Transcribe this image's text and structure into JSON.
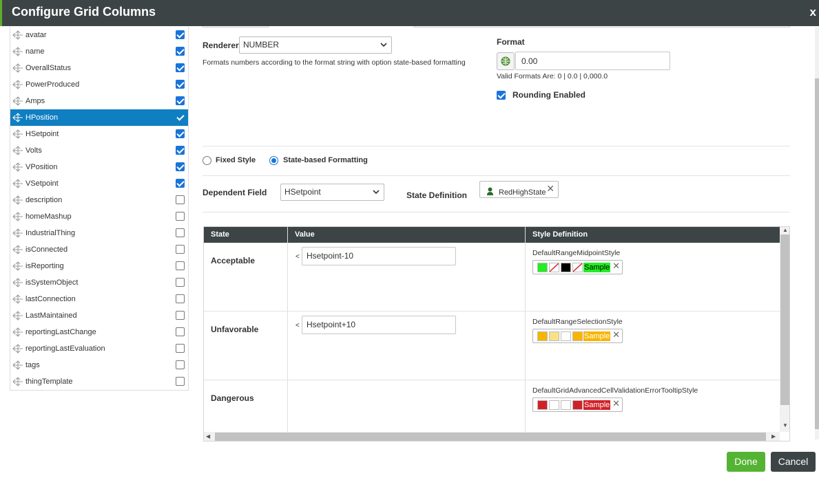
{
  "dialog": {
    "title": "Configure Grid Columns",
    "close": "x"
  },
  "columns": [
    {
      "label": "avatar",
      "checked": true
    },
    {
      "label": "name",
      "checked": true
    },
    {
      "label": "OverallStatus",
      "checked": true
    },
    {
      "label": "PowerProduced",
      "checked": true
    },
    {
      "label": "Amps",
      "checked": true
    },
    {
      "label": "HPosition",
      "checked": true,
      "selected": true
    },
    {
      "label": "HSetpoint",
      "checked": true
    },
    {
      "label": "Volts",
      "checked": true
    },
    {
      "label": "VPosition",
      "checked": true
    },
    {
      "label": "VSetpoint",
      "checked": true
    },
    {
      "label": "description",
      "checked": false
    },
    {
      "label": "homeMashup",
      "checked": false
    },
    {
      "label": "IndustrialThing",
      "checked": false
    },
    {
      "label": "isConnected",
      "checked": false
    },
    {
      "label": "isReporting",
      "checked": false
    },
    {
      "label": "isSystemObject",
      "checked": false
    },
    {
      "label": "lastConnection",
      "checked": false
    },
    {
      "label": "LastMaintained",
      "checked": false
    },
    {
      "label": "reportingLastChange",
      "checked": false
    },
    {
      "label": "reportingLastEvaluation",
      "checked": false
    },
    {
      "label": "tags",
      "checked": false
    },
    {
      "label": "thingTemplate",
      "checked": false
    }
  ],
  "renderer": {
    "label": "Renderer",
    "value": "NUMBER",
    "description": "Formats numbers according to the format string with option state-based formatting"
  },
  "format": {
    "label": "Format",
    "value": "0.00",
    "valid_formats": "Valid Formats Are: 0 | 0.0 | 0,000.0",
    "rounding_label": "Rounding Enabled",
    "rounding_checked": true
  },
  "style_mode": {
    "fixed_label": "Fixed Style",
    "state_label": "State-based Formatting",
    "selected": "state"
  },
  "dependent_field": {
    "label": "Dependent Field",
    "value": "HSetpoint"
  },
  "state_definition": {
    "label": "State Definition",
    "value": "RedHighState"
  },
  "state_grid": {
    "headers": {
      "state": "State",
      "value": "Value",
      "style": "Style Definition"
    },
    "sample_label": "Sample",
    "rows": [
      {
        "state": "Acceptable",
        "operator": "<",
        "value": "Hsetpoint-10",
        "style_name": "DefaultRangeMidpointStyle",
        "swatches": [
          "#22ee22",
          "none",
          "#000000",
          "none"
        ],
        "sample_bg": "#22ee22",
        "sample_fg": "#000000"
      },
      {
        "state": "Unfavorable",
        "operator": "<",
        "value": "Hsetpoint+10",
        "style_name": "DefaultRangeSelectionStyle",
        "swatches": [
          "#f7b500",
          "#fbe08a",
          "#ffffff",
          "#f7b500"
        ],
        "sample_bg": "#f7b500",
        "sample_fg": "#ffffff"
      },
      {
        "state": "Dangerous",
        "operator": "",
        "value": "",
        "style_name": "DefaultGridAdvancedCellValidationErrorTooltipStyle",
        "swatches": [
          "#d12128",
          "#ffffff",
          "#ffffff",
          "#d12128"
        ],
        "sample_bg": "#d12128",
        "sample_fg": "#ffffff"
      }
    ]
  },
  "buttons": {
    "done": "Done",
    "cancel": "Cancel"
  },
  "colors": {
    "titlebar": "#3d4446",
    "accent_green": "#55b334",
    "selection_blue": "#0f7fc1",
    "checkbox_blue": "#1a73d9"
  }
}
